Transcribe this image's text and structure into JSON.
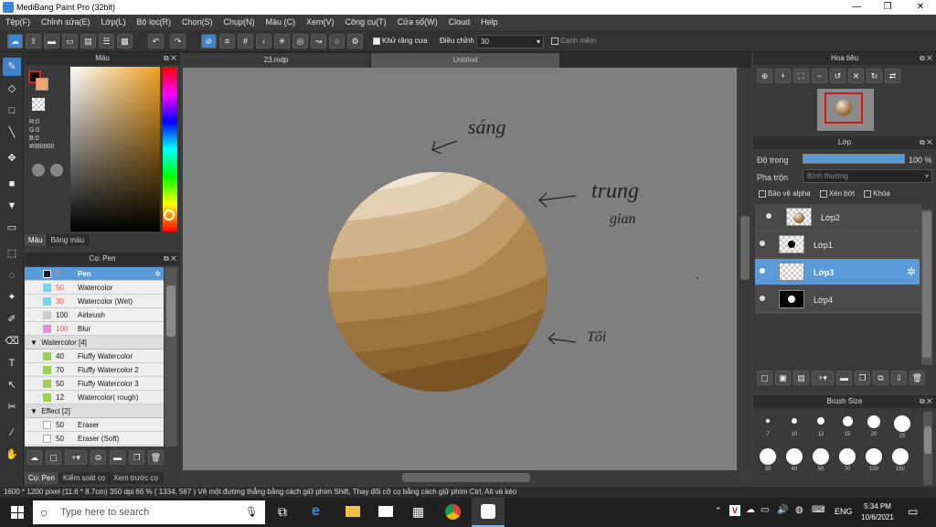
{
  "window": {
    "title": "MediBang Paint Pro (32bit)"
  },
  "menu": [
    "Tệp(F)",
    "Chỉnh sửa(E)",
    "Lớp(L)",
    "Bộ lọc(R)",
    "Chọn(S)",
    "Chụp(N)",
    "Màu (C)",
    "Xem(V)",
    "Công cụ(T)",
    "Cửa sổ(W)",
    "Cloud",
    "Help"
  ],
  "toolbar": {
    "antialias_label": "Khử răng cưa",
    "correction_label": "Điều chỉnh",
    "correction_value": "30",
    "edge_label": "Canh mềm"
  },
  "color_panel": {
    "title": "Màu",
    "r": "R:0",
    "g": "G:0",
    "b": "B:0",
    "hex": "#000000",
    "tabs": [
      "Màu",
      "Bảng màu"
    ]
  },
  "brush_panel": {
    "title": "Cọ: Pen",
    "items": [
      {
        "size": "2",
        "name": "Pen",
        "color": "#1a1a1a",
        "selected": true
      },
      {
        "size": "50",
        "name": "Watercolor",
        "color": "#6fd8f0"
      },
      {
        "size": "30",
        "name": "Watercolor (Wet)",
        "color": "#6fd8f0"
      },
      {
        "size": "100",
        "name": "Airbrush",
        "color": "#cccccc"
      },
      {
        "size": "100",
        "name": "Blur",
        "color": "#ef8ae0"
      }
    ],
    "group1": "Watercolor [4]",
    "group1_items": [
      {
        "size": "40",
        "name": "Fluffy Watercolor",
        "color": "#9ad24a"
      },
      {
        "size": "70",
        "name": "Fluffy Watercolor 2",
        "color": "#9ad24a"
      },
      {
        "size": "50",
        "name": "Fluffy Watercolor 3",
        "color": "#9ad24a"
      },
      {
        "size": "12",
        "name": "Watercolor( rough)",
        "color": "#9ad24a"
      }
    ],
    "group2": "Effect [2]",
    "group2_items": [
      {
        "size": "50",
        "name": "Eraser",
        "color": "#ffffff"
      },
      {
        "size": "50",
        "name": "Eraser (Soft)",
        "color": "#ffffff"
      }
    ],
    "bottom_tabs": [
      "Cọ: Pen",
      "Kiểm soát cọ",
      "Xem trước cọ"
    ]
  },
  "doc_tabs": [
    "23.mdp",
    "Untitled"
  ],
  "canvas": {
    "note_light": "sáng",
    "note_mid1": "trung",
    "note_mid2": "gian",
    "note_dark": "Tối"
  },
  "navigator": {
    "title": "Hoa tiêu"
  },
  "layer_panel": {
    "title": "Lớp",
    "opacity_label": "Độ trong",
    "opacity_value": "100 %",
    "blend_label": "Pha trộn",
    "blend_value": "Bình thường",
    "protect_alpha": "Bảo vệ alpha",
    "clipping": "Xén bớt",
    "lock": "Khóa",
    "layers": [
      {
        "name": "Lớp2",
        "selected": false
      },
      {
        "name": "Lớp1",
        "selected": false
      },
      {
        "name": "Lớp3",
        "selected": true
      },
      {
        "name": "Lớp4",
        "selected": false
      }
    ]
  },
  "brush_size_panel": {
    "title": "Brush Size",
    "sizes": [
      "7",
      "10",
      "12",
      "15",
      "20",
      "25",
      "30",
      "40",
      "50",
      "70",
      "100",
      "150"
    ]
  },
  "status": "1600 * 1200 pixel   (11.6 * 8.7cm)   350 dpi   66 %   ( 1334, 567 )   Vẽ một đường thẳng bằng cách giữ phím Shift, Thay đổi cỡ cọ bằng cách giữ phím Ctrl, Alt và kéo",
  "taskbar": {
    "search_placeholder": "Type here to search",
    "lang": "ENG",
    "time": "5:34 PM",
    "date": "10/6/2021"
  }
}
